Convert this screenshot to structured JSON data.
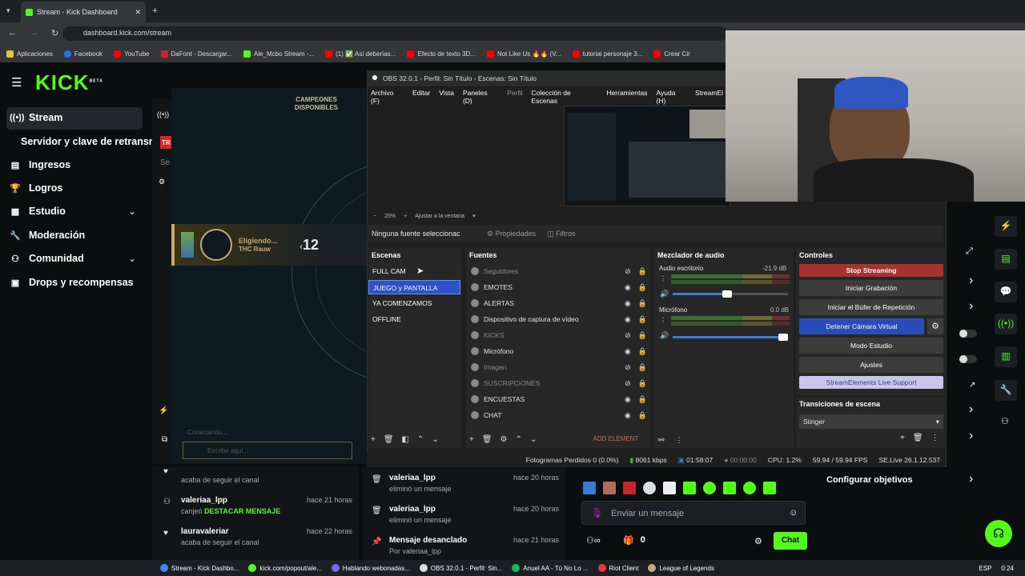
{
  "browser": {
    "tab_title": "Stream - Kick Dashboard",
    "url": "dashboard.kick.com/stream",
    "bookmarks": [
      "Aplicaciones",
      "Facebook",
      "YouTube",
      "DaFont - Descargar...",
      "Ale_Mcbo Stream -...",
      "(1) ✅ Así deberías...",
      "Efecto de texto 3D...",
      "Not Like Us 🔥🔥 (V...",
      "tutorial personaje 3...",
      "Crear Cir"
    ]
  },
  "kick": {
    "logo": "KICK",
    "logo_badge": "BETA",
    "nav": [
      {
        "label": "Stream"
      },
      {
        "label": "Servidor y clave de retransm"
      },
      {
        "label": "Ingresos"
      },
      {
        "label": "Logros"
      },
      {
        "label": "Estudio"
      },
      {
        "label": "Moderación"
      },
      {
        "label": "Comunidad"
      },
      {
        "label": "Drops y recompensas"
      }
    ],
    "tr_badge": "TR",
    "se_text": "Se"
  },
  "game": {
    "champions_label": "CAMPEONES DISPONIBLES",
    "banner_text": "Eligiendo...",
    "banner_player": "THC Rauw",
    "banner_number": "12",
    "connecting": "Conectando...",
    "chat_placeholder": "Escribe aquí..."
  },
  "obs": {
    "title": "OBS 32.0.1 - Perfil: Sin Título - Escenas: Sin Título",
    "menu": [
      "Archivo (F)",
      "Editar",
      "Vista",
      "Paneles (D)",
      "Perfil",
      "Colección de Escenas",
      "Herramientas",
      "Ayuda (H)",
      "StreamEl"
    ],
    "zoom": "25%",
    "fit": "Ajustar a la ventana",
    "no_source": "Ninguna fuente seleccionac",
    "properties": "Propiedades",
    "filters": "Filtros",
    "scenes_header": "Escenas",
    "scenes": [
      "FULL CAM",
      "JUEGO y PANTALLA",
      "YA COMENZAMOS",
      "OFFLINE"
    ],
    "sources_header": "Fuentes",
    "sources": [
      {
        "name": "Seguidores",
        "dim": true
      },
      {
        "name": "EMOTES",
        "dim": false
      },
      {
        "name": "ALERTAS",
        "dim": false
      },
      {
        "name": "Dispositivo de captura de vídeo",
        "dim": false
      },
      {
        "name": "KICKS",
        "dim": true
      },
      {
        "name": "Micrófono",
        "dim": false
      },
      {
        "name": "Imagen",
        "dim": true
      },
      {
        "name": "SUSCRIPCIONES",
        "dim": true
      },
      {
        "name": "ENCUESTAS",
        "dim": false
      },
      {
        "name": "CHAT",
        "dim": false
      }
    ],
    "add_element": "ADD ELEMENT",
    "mixer_header": "Mezclador de audio",
    "audio_desktop": "Audio escritorio",
    "audio_desktop_db": "-21.9 dB",
    "mic": "Micrófono",
    "mic_db": "0.0 dB",
    "controls_header": "Controles",
    "controls": [
      "Stop Streaming",
      "Iniciar Grabación",
      "Iniciar el Búfer de Repetición",
      "Detener Cámara Virtual",
      "Modo Estudio",
      "Ajustes",
      "StreamElements Live Support"
    ],
    "transitions_header": "Transiciones de escena",
    "transition": "Stinger",
    "status": {
      "dropped": "Fotogramas Perdidos 0 (0.0%)",
      "bitrate": "8061 kbps",
      "time_live": "01:58:07",
      "time_rec": "00:00:00",
      "cpu": "CPU: 1.2%",
      "fps": "59.94 / 59.94 FPS",
      "se": "SE.Live 26.1.12.537"
    },
    "colors": {
      "stop": "#a7322e",
      "camera": "#284cb8",
      "selected_scene": "#2d52c8"
    }
  },
  "feed": [
    {
      "user": "",
      "action": "acaba de seguir el canal",
      "time": ""
    },
    {
      "user": "valeriaa_lpp",
      "action": "canjeó",
      "highlight": "DESTACAR MENSAJE",
      "time": "hace 21 horas"
    },
    {
      "user": "lauravaleriar",
      "action": "acaba de seguir el canal",
      "time": "hace 22 horas"
    }
  ],
  "modlog": [
    {
      "user": "valeriaa_lpp",
      "action": "eliminó un mensaje",
      "time": "hace 20 horas"
    },
    {
      "user": "valeriaa_lpp",
      "action": "eliminó un mensaje",
      "time": "hace 20 horas"
    },
    {
      "user": "Mensaje desanclado",
      "action": "Por valeriaa_lpp",
      "time": "hace 21 horas"
    }
  ],
  "chat": {
    "placeholder": "Enviar un mensaje",
    "count": "0",
    "button": "Chat"
  },
  "goals": "Configurar objetivos",
  "taskbar": [
    "Stream - Kick Dashbo...",
    "kick.com/popout/ale...",
    "Hablando webonadas...",
    "OBS 32.0.1 - Perfil: Sin...",
    "Anuel AA - Tú No Lo ...",
    "Riot Client",
    "League of Legends",
    "ESP",
    "0:24"
  ]
}
